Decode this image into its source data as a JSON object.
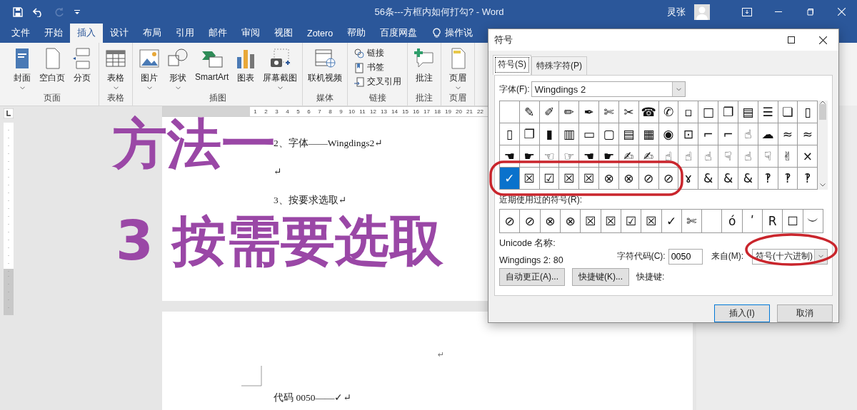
{
  "title_bar": {
    "title": "56条---方框内如何打勾?  - Word",
    "user": "灵张",
    "redo_disabled": true
  },
  "menu_tabs": [
    {
      "label": "文件",
      "selected": false
    },
    {
      "label": "开始",
      "selected": false
    },
    {
      "label": "插入",
      "selected": true
    },
    {
      "label": "设计",
      "selected": false
    },
    {
      "label": "布局",
      "selected": false
    },
    {
      "label": "引用",
      "selected": false
    },
    {
      "label": "邮件",
      "selected": false
    },
    {
      "label": "审阅",
      "selected": false
    },
    {
      "label": "视图",
      "selected": false
    },
    {
      "label": "Zotero",
      "selected": false
    },
    {
      "label": "帮助",
      "selected": false
    },
    {
      "label": "百度网盘",
      "selected": false
    }
  ],
  "tell_me": "操作说",
  "ribbon_groups": [
    {
      "label": "页面",
      "kind": "large",
      "items": [
        {
          "label": "封面",
          "dropdown": true
        },
        {
          "label": "空白页",
          "dropdown": false
        },
        {
          "label": "分页",
          "dropdown": false
        }
      ]
    },
    {
      "label": "表格",
      "kind": "large",
      "items": [
        {
          "label": "表格",
          "dropdown": true
        }
      ]
    },
    {
      "label": "插图",
      "kind": "large",
      "items": [
        {
          "label": "图片",
          "dropdown": true
        },
        {
          "label": "形状",
          "dropdown": true
        },
        {
          "label": "SmartArt",
          "dropdown": false
        },
        {
          "label": "图表",
          "dropdown": false
        },
        {
          "label": "屏幕截图",
          "dropdown": true
        }
      ]
    },
    {
      "label": "媒体",
      "kind": "large",
      "items": [
        {
          "label": "联机视频",
          "dropdown": false
        }
      ]
    },
    {
      "label": "链接",
      "kind": "stack",
      "items": [
        {
          "label": "链接",
          "dropdown": false
        },
        {
          "label": "书签",
          "dropdown": false
        },
        {
          "label": "交叉引用",
          "dropdown": false
        }
      ]
    },
    {
      "label": "批注",
      "kind": "large",
      "items": [
        {
          "label": "批注",
          "dropdown": false
        }
      ]
    },
    {
      "label": "页眉",
      "kind": "large",
      "items": [
        {
          "label": "页眉",
          "dropdown": true
        }
      ]
    }
  ],
  "ruler": {
    "numbers": [
      "1",
      "2",
      "3",
      "4",
      "5",
      "6",
      "7",
      "8",
      "9",
      "10",
      "11",
      "12",
      "13",
      "14",
      "15",
      "16",
      "17",
      "18",
      "19",
      "20",
      "21",
      "22"
    ]
  },
  "document": {
    "page1_lines": [
      "2、字体——Wingdings2↵",
      "↵",
      "3、按要求选取↵"
    ],
    "page2_mark": "↵",
    "page2_lines": [
      "代码 0050——✓↵"
    ]
  },
  "overlay_captions": [
    "方法一",
    "3 按需要选取"
  ],
  "dialog": {
    "title": "符号",
    "tabs": [
      {
        "label": "符号(S)",
        "selected": true
      },
      {
        "label": "特殊字符(P)",
        "selected": false
      }
    ],
    "font_label": "字体(F):",
    "font_value": "Wingdings 2",
    "symbol_rows": [
      [
        {
          "selected": false
        },
        {
          "glyph": "✎",
          "selected": false
        },
        {
          "glyph": "✐",
          "selected": false
        },
        {
          "glyph": "✏",
          "selected": false
        },
        {
          "glyph": "✒",
          "selected": false
        },
        {
          "glyph": "✄",
          "selected": false
        },
        {
          "glyph": "✂",
          "selected": false
        },
        {
          "glyph": "☎",
          "selected": false
        },
        {
          "glyph": "✆",
          "selected": false
        },
        {
          "glyph": "▫",
          "selected": false
        },
        {
          "glyph": "□",
          "selected": false
        },
        {
          "glyph": "❐",
          "selected": false
        },
        {
          "glyph": "▤",
          "selected": false
        },
        {
          "glyph": "☰",
          "selected": false
        },
        {
          "glyph": "❏",
          "selected": false
        },
        {
          "glyph": "▯",
          "selected": false
        }
      ],
      [
        {
          "glyph": "▯",
          "selected": false
        },
        {
          "glyph": "❐",
          "selected": false
        },
        {
          "glyph": "▮",
          "selected": false
        },
        {
          "glyph": "▥",
          "selected": false
        },
        {
          "glyph": "▭",
          "selected": false
        },
        {
          "glyph": "▢",
          "selected": false
        },
        {
          "glyph": "▤",
          "selected": false
        },
        {
          "glyph": "▦",
          "selected": false
        },
        {
          "glyph": "◉",
          "selected": false
        },
        {
          "glyph": "⊡",
          "selected": false
        },
        {
          "glyph": "⌐",
          "selected": false
        },
        {
          "glyph": "⌐",
          "selected": false
        },
        {
          "glyph": "☝",
          "selected": false
        },
        {
          "glyph": "☁",
          "selected": false
        },
        {
          "glyph": "≈",
          "selected": false
        },
        {
          "glyph": "≈",
          "selected": false
        }
      ],
      [
        {
          "glyph": "☚",
          "selected": false
        },
        {
          "glyph": "☛",
          "selected": false
        },
        {
          "glyph": "☜",
          "selected": false
        },
        {
          "glyph": "☞",
          "selected": false
        },
        {
          "glyph": "☚",
          "selected": false
        },
        {
          "glyph": "☛",
          "selected": false
        },
        {
          "glyph": "✍",
          "selected": false
        },
        {
          "glyph": "✍",
          "selected": false
        },
        {
          "glyph": "☝",
          "selected": false
        },
        {
          "glyph": "☝",
          "selected": false
        },
        {
          "glyph": "☝",
          "selected": false
        },
        {
          "glyph": "☟",
          "selected": false
        },
        {
          "glyph": "☝",
          "selected": false
        },
        {
          "glyph": "☟",
          "selected": false
        },
        {
          "glyph": "✌",
          "selected": false
        },
        {
          "glyph": "×",
          "selected": false
        }
      ],
      [
        {
          "glyph": "✓",
          "selected": true
        },
        {
          "glyph": "☒",
          "selected": false
        },
        {
          "glyph": "☑",
          "selected": false
        },
        {
          "glyph": "☒",
          "selected": false
        },
        {
          "glyph": "☒",
          "selected": false
        },
        {
          "glyph": "⊗",
          "selected": false
        },
        {
          "glyph": "⊗",
          "selected": false
        },
        {
          "glyph": "⊘",
          "selected": false
        },
        {
          "glyph": "⊘",
          "selected": false
        },
        {
          "glyph": "ɤ",
          "selected": false
        },
        {
          "glyph": "&",
          "selected": false
        },
        {
          "glyph": "&",
          "selected": false
        },
        {
          "glyph": "&",
          "selected": false
        },
        {
          "glyph": "‽",
          "selected": false
        },
        {
          "glyph": "‽",
          "selected": false
        },
        {
          "glyph": "‽",
          "selected": false
        }
      ]
    ],
    "recent_label": "近期使用过的符号(R):",
    "recent_symbols": [
      {
        "glyph": "⊘",
        "selected": false
      },
      {
        "glyph": "⊘",
        "selected": false
      },
      {
        "glyph": "⊗",
        "selected": false
      },
      {
        "glyph": "⊗",
        "selected": false
      },
      {
        "glyph": "☒",
        "selected": false
      },
      {
        "glyph": "☒",
        "selected": false
      },
      {
        "glyph": "☑",
        "selected": false
      },
      {
        "glyph": "☒",
        "selected": false
      },
      {
        "glyph": "✓",
        "selected": false
      },
      {
        "glyph": "✄",
        "selected": false
      },
      {
        "selected": false
      },
      {
        "glyph": "ó",
        "selected": false
      },
      {
        "glyph": "ʹ",
        "selected": false
      },
      {
        "glyph": "R",
        "selected": false
      },
      {
        "glyph": "☐",
        "selected": false
      },
      {
        "glyph": "︶",
        "selected": false
      }
    ],
    "unicode_name_label": "Unicode 名称:",
    "unicode_name": "Wingdings 2: 80",
    "char_code_label": "字符代码(C):",
    "char_code": "0050",
    "from_label": "来自(M):",
    "from_value": "符号(十六进制)",
    "buttons": [
      "自动更正(A)...",
      "快捷键(K)..."
    ],
    "shortcut_label": "快捷键:",
    "footer_buttons": [
      {
        "label": "插入(I)",
        "default": true
      },
      {
        "label": "取消",
        "default": false
      }
    ]
  }
}
